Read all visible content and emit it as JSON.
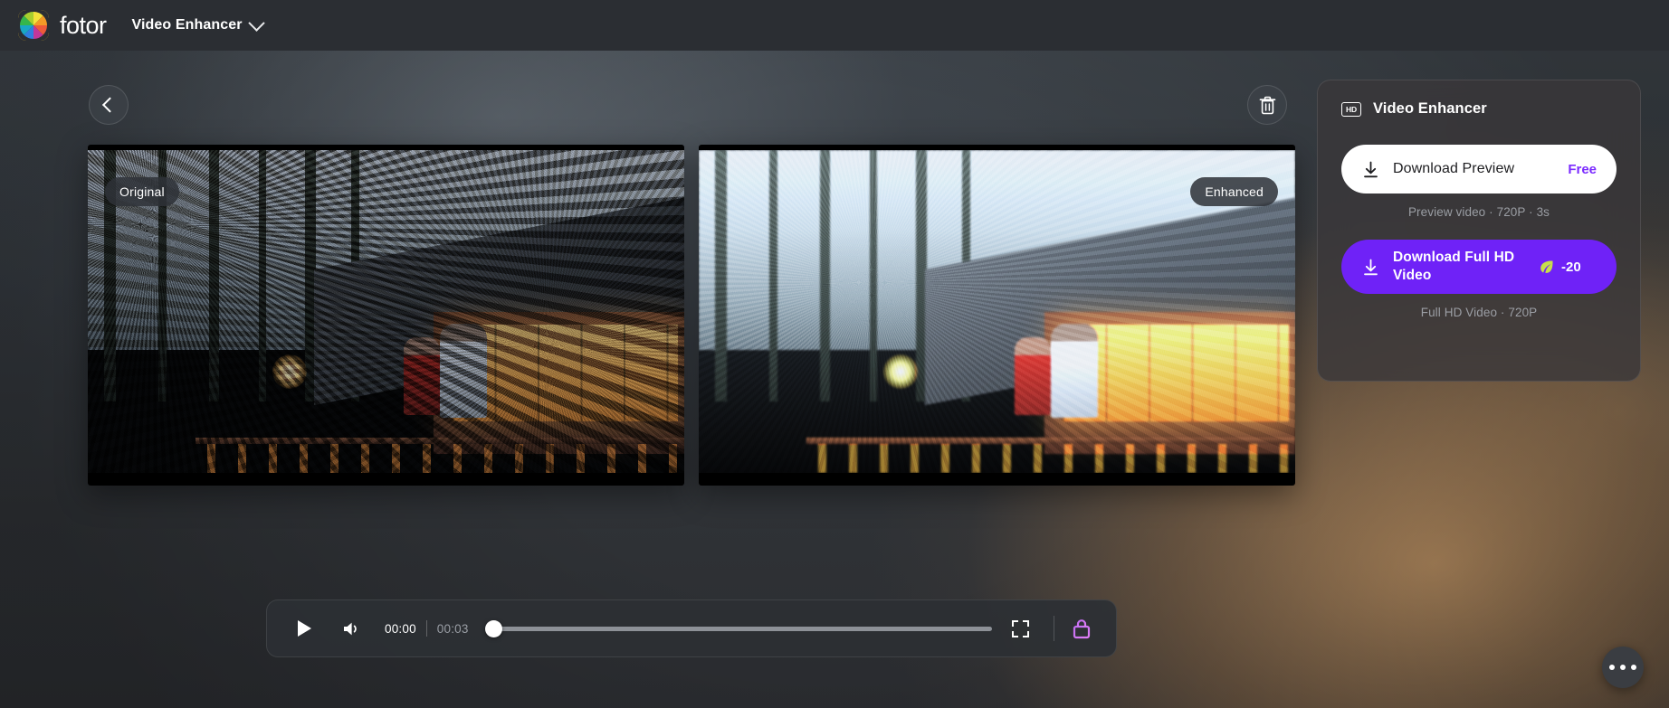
{
  "topbar": {
    "brand": "fotor",
    "logo_icon": "fotor-color-wheel-logo",
    "tool_name": "Video Enhancer",
    "tool_chevron_icon": "chevron-down-icon"
  },
  "toolbar": {
    "back_icon": "chevron-left-icon",
    "delete_icon": "trash-icon",
    "more_icon": "ellipsis-horizontal-icon"
  },
  "comparison": {
    "original_label": "Original",
    "enhanced_label": "Enhanced"
  },
  "player": {
    "play_icon": "play-icon",
    "volume_icon": "volume-icon",
    "current_time": "00:00",
    "total_time": "00:03",
    "fullscreen_icon": "fullscreen-icon",
    "lock_icon": "lock-icon",
    "progress_percent": 0
  },
  "panel": {
    "badge_icon": "hd-badge-icon",
    "badge_text": "HD",
    "title": "Video Enhancer",
    "download_icon": "download-icon",
    "preview": {
      "label": "Download Preview",
      "price": "Free",
      "caption": "Preview video · 720P · 3s"
    },
    "fullhd": {
      "label": "Download Full HD Video",
      "credit_icon": "leaf-credit-icon",
      "credit_amount": "-20",
      "caption": "Full HD Video · 720P"
    }
  },
  "colors": {
    "accent_purple": "#6f22f7",
    "price_purple": "#7b2bff",
    "credit_green": "#c7e04a",
    "panel_bg": "#39373a",
    "topbar_bg": "#2b2e33"
  }
}
